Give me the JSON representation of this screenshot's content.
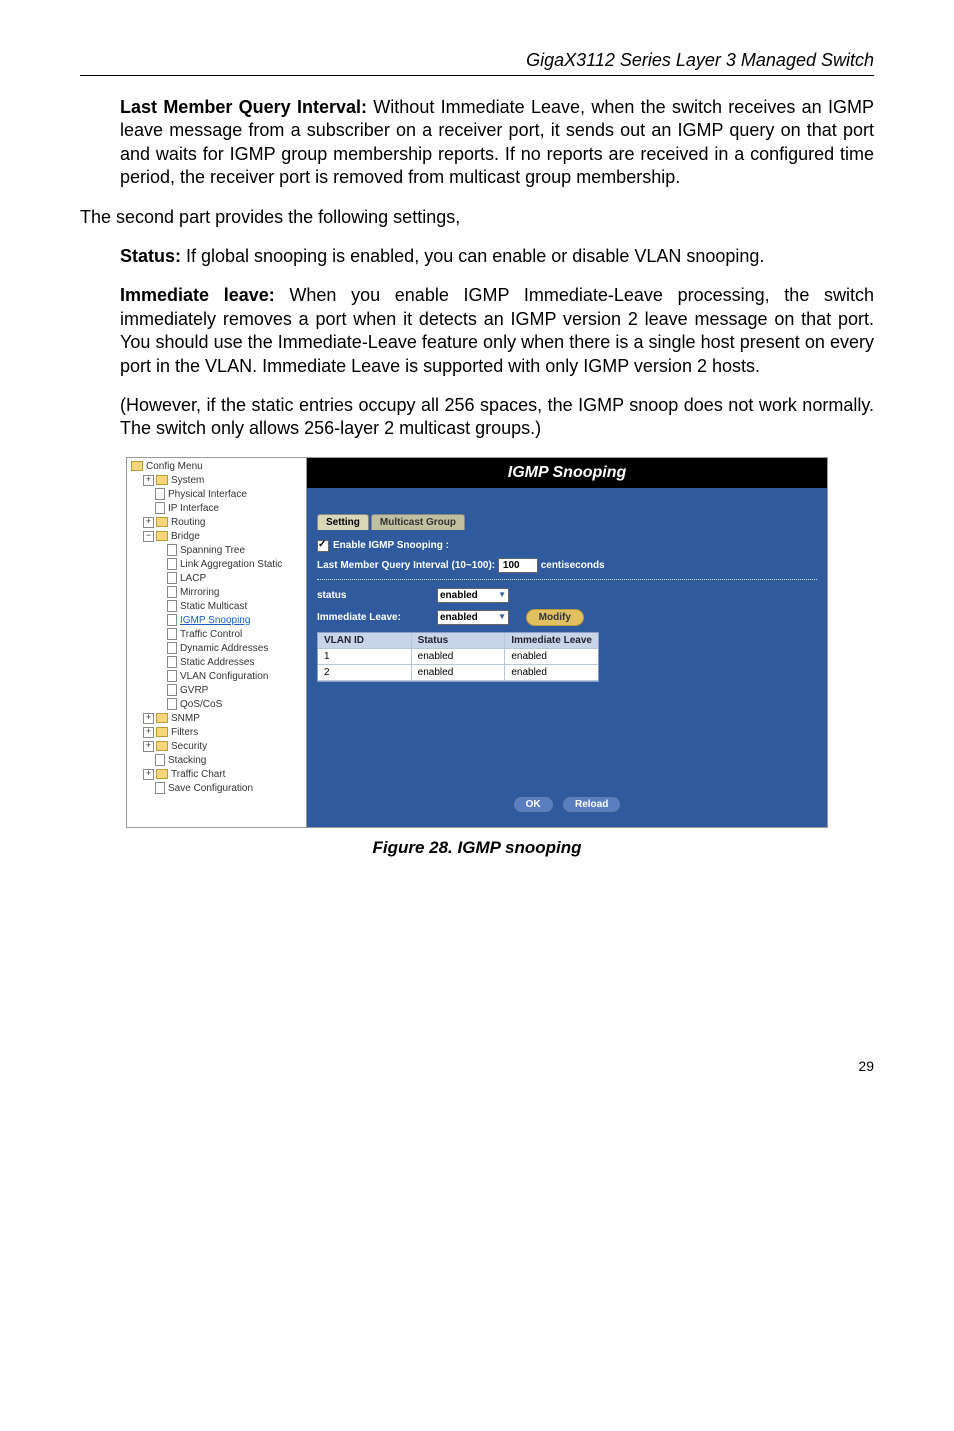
{
  "header": "GigaX3112 Series Layer 3 Managed Switch",
  "p1_bold": "Last Member Query Interval:",
  "p1": " Without Immediate Leave, when the switch receives an IGMP leave message from a subscriber on a receiver port, it sends out an IGMP query on that port and waits for IGMP group membership reports. If no reports are received in a configured time period, the receiver port is removed from multicast group membership.",
  "p2": "The second part provides the following settings,",
  "p3_bold": "Status:",
  "p3": " If global snooping is enabled, you can enable or disable VLAN snooping.",
  "p4_bold": "Immediate leave:",
  "p4": " When you enable IGMP Immediate-Leave processing, the switch immediately removes a port when it detects an IGMP version 2 leave message on that port. You should use the Immediate-Leave feature only when there is a single host present on every port in the VLAN. Immediate Leave is supported with only IGMP version 2 hosts.",
  "p5": "(However, if the static entries occupy all 256 spaces, the IGMP snoop does not work normally. The switch only allows 256-layer 2 multicast groups.)",
  "figcap": "Figure 28. IGMP snooping",
  "pagenum": "29",
  "tree": [
    {
      "lvl": 0,
      "type": "folder",
      "toggle": "",
      "label": "Config Menu"
    },
    {
      "lvl": 1,
      "type": "folder",
      "toggle": "+",
      "label": "System"
    },
    {
      "lvl": 2,
      "type": "file",
      "label": "Physical Interface"
    },
    {
      "lvl": 2,
      "type": "file",
      "label": "IP Interface"
    },
    {
      "lvl": 1,
      "type": "folder",
      "toggle": "+",
      "label": "Routing"
    },
    {
      "lvl": 1,
      "type": "folder",
      "toggle": "−",
      "label": "Bridge"
    },
    {
      "lvl": 3,
      "type": "file",
      "label": "Spanning Tree"
    },
    {
      "lvl": 3,
      "type": "file",
      "label": "Link Aggregation Static"
    },
    {
      "lvl": 3,
      "type": "file",
      "label": "LACP"
    },
    {
      "lvl": 3,
      "type": "file",
      "label": "Mirroring"
    },
    {
      "lvl": 3,
      "type": "file",
      "label": "Static Multicast"
    },
    {
      "lvl": 3,
      "type": "file",
      "label": "IGMP Snooping",
      "sel": true
    },
    {
      "lvl": 3,
      "type": "file",
      "label": "Traffic Control"
    },
    {
      "lvl": 3,
      "type": "file",
      "label": "Dynamic Addresses"
    },
    {
      "lvl": 3,
      "type": "file",
      "label": "Static Addresses"
    },
    {
      "lvl": 3,
      "type": "file",
      "label": "VLAN Configuration"
    },
    {
      "lvl": 3,
      "type": "file",
      "label": "GVRP"
    },
    {
      "lvl": 3,
      "type": "file",
      "label": "QoS/CoS"
    },
    {
      "lvl": 1,
      "type": "folder",
      "toggle": "+",
      "label": "SNMP"
    },
    {
      "lvl": 1,
      "type": "folder",
      "toggle": "+",
      "label": "Filters"
    },
    {
      "lvl": 1,
      "type": "folder",
      "toggle": "+",
      "label": "Security"
    },
    {
      "lvl": 2,
      "type": "file",
      "label": "Stacking"
    },
    {
      "lvl": 1,
      "type": "folder",
      "toggle": "+",
      "label": "Traffic Chart"
    },
    {
      "lvl": 2,
      "type": "file",
      "label": "Save Configuration"
    }
  ],
  "panel": {
    "title": "IGMP Snooping",
    "tab1": "Setting",
    "tab2": "Multicast Group",
    "enable_label": "Enable IGMP Snooping :",
    "lastmember_label": "Last Member Query Interval (10~100):",
    "lastmember_value": "100",
    "lastmember_unit": "centiseconds",
    "status_label": "status",
    "status_value": "enabled",
    "imm_label": "Immediate Leave:",
    "imm_value": "enabled",
    "modify": "Modify",
    "table": {
      "h1": "VLAN ID",
      "h2": "Status",
      "h3": "Immediate Leave",
      "rows": [
        {
          "c1": "1",
          "c2": "enabled",
          "c3": "enabled"
        },
        {
          "c1": "2",
          "c2": "enabled",
          "c3": "enabled"
        }
      ]
    },
    "ok": "OK",
    "reload": "Reload"
  }
}
